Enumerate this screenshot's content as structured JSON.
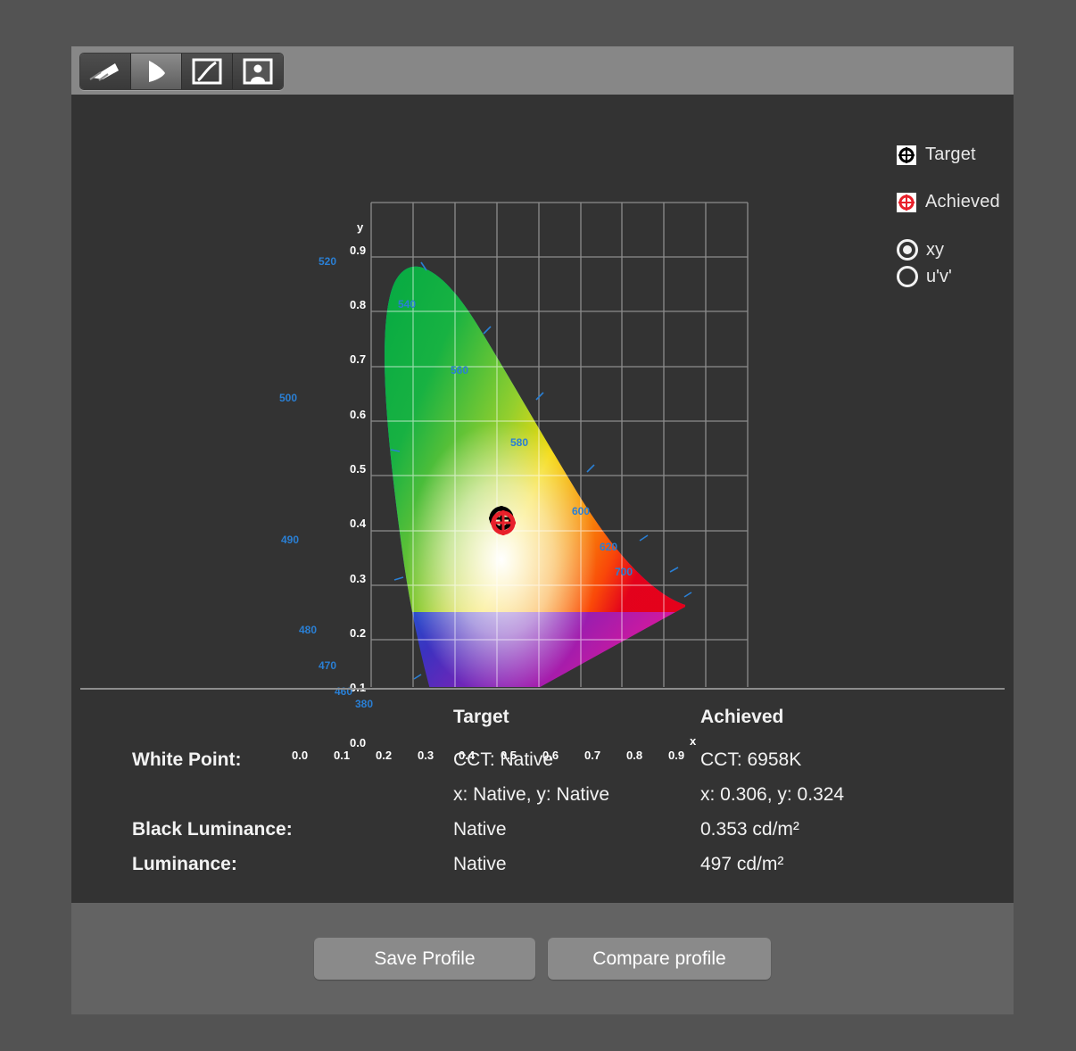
{
  "toolbar": {
    "buttons": [
      {
        "name": "gamut-3d-icon",
        "label": "3D Gamut",
        "selected": false
      },
      {
        "name": "gamut-2d-icon",
        "label": "2D Chromaticity",
        "selected": true
      },
      {
        "name": "tone-curve-icon",
        "label": "Tone Curve",
        "selected": false
      },
      {
        "name": "image-preview-icon",
        "label": "Image Preview",
        "selected": false
      }
    ]
  },
  "legend": {
    "items": [
      {
        "label": "Target",
        "marker": "crosshair-circle",
        "color": "#000000"
      },
      {
        "label": "Achieved",
        "marker": "crosshair-circle",
        "color": "#e8202a"
      }
    ],
    "radios": [
      {
        "label": "xy",
        "selected": true
      },
      {
        "label": "u'v'",
        "selected": false
      }
    ]
  },
  "chart_data": {
    "type": "scatter",
    "title": "",
    "xlabel": "x",
    "ylabel": "y",
    "xlim": [
      0.0,
      0.9
    ],
    "ylim": [
      0.0,
      0.9
    ],
    "xticks": [
      "0.0",
      "0.1",
      "0.2",
      "0.3",
      "0.4",
      "0.5",
      "0.6",
      "0.7",
      "0.8",
      "0.9"
    ],
    "yticks": [
      "0.0",
      "0.1",
      "0.2",
      "0.3",
      "0.4",
      "0.5",
      "0.6",
      "0.7",
      "0.8",
      "0.9"
    ],
    "grid": true,
    "legend_position": "top-right",
    "wavelength_labels": [
      {
        "nm": "520",
        "x": 0.075,
        "y": 0.835
      },
      {
        "nm": "540",
        "x": 0.232,
        "y": 0.755
      },
      {
        "nm": "560",
        "x": 0.372,
        "y": 0.63
      },
      {
        "nm": "580",
        "x": 0.512,
        "y": 0.51
      },
      {
        "nm": "600",
        "x": 0.625,
        "y": 0.39
      },
      {
        "nm": "620",
        "x": 0.687,
        "y": 0.318
      },
      {
        "nm": "700",
        "x": 0.735,
        "y": 0.272
      },
      {
        "nm": "500",
        "x": 0.012,
        "y": 0.533
      },
      {
        "nm": "490",
        "x": 0.022,
        "y": 0.302
      },
      {
        "nm": "480",
        "x": 0.048,
        "y": 0.127
      },
      {
        "nm": "470",
        "x": 0.085,
        "y": 0.05
      },
      {
        "nm": "460",
        "x": 0.132,
        "y": 0.018
      },
      {
        "nm": "380",
        "x": 0.165,
        "y": -0.012
      }
    ],
    "series": [
      {
        "name": "Target",
        "x": 0.306,
        "y": 0.324,
        "color": "#000000"
      },
      {
        "name": "Achieved",
        "x": 0.306,
        "y": 0.324,
        "color": "#e8202a"
      }
    ]
  },
  "results": {
    "col_target": "Target",
    "col_achieved": "Achieved",
    "rows": [
      {
        "label": "White Point:",
        "target": "CCT: Native",
        "achieved": "CCT: 6958K"
      },
      {
        "label": "",
        "target": "x: Native, y: Native",
        "achieved": "x: 0.306, y: 0.324"
      },
      {
        "label": "Black Luminance:",
        "target": "Native",
        "achieved": "0.353 cd/m²"
      },
      {
        "label": "Luminance:",
        "target": "Native",
        "achieved": "497 cd/m²"
      }
    ]
  },
  "footer": {
    "save_label": "Save Profile",
    "compare_label": "Compare profile"
  },
  "colors": {
    "window_bg": "#333333",
    "outer_bg": "#535353",
    "toolbar_bg": "#878787",
    "footer_bg": "#636363",
    "accent_red": "#e8202a",
    "wavelength_blue": "#2a7fd4"
  }
}
